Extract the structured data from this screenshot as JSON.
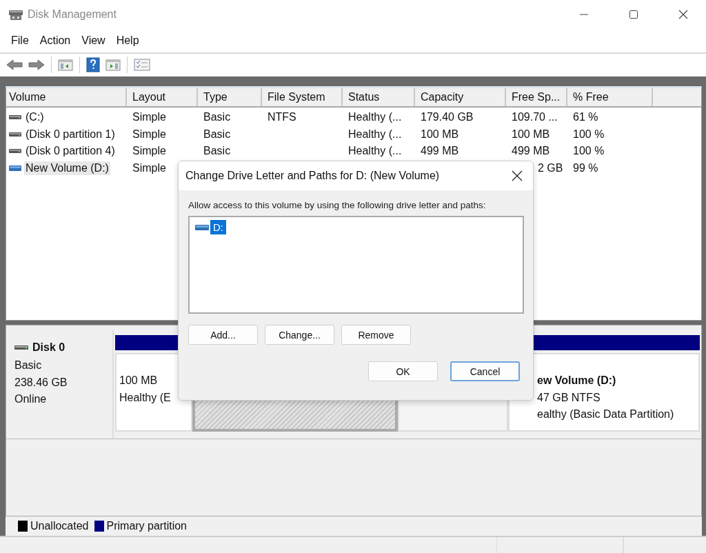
{
  "window": {
    "title": "Disk Management"
  },
  "menu": [
    "File",
    "Action",
    "View",
    "Help"
  ],
  "volume_list": {
    "columns": [
      "Volume",
      "Layout",
      "Type",
      "File System",
      "Status",
      "Capacity",
      "Free Sp...",
      "% Free"
    ],
    "rows": [
      {
        "kind": "system",
        "selected": false,
        "cells": [
          {
            "text": "(C:)"
          },
          {
            "text": "Simple"
          },
          {
            "text": "Basic"
          },
          {
            "text": "NTFS"
          },
          {
            "text": "Healthy (..."
          },
          {
            "text": "179.40 GB"
          },
          {
            "text": "109.70 ..."
          },
          {
            "text": "61 %"
          }
        ]
      },
      {
        "kind": "system",
        "selected": false,
        "cells": [
          {
            "text": "(Disk 0 partition 1)"
          },
          {
            "text": "Simple"
          },
          {
            "text": "Basic"
          },
          null,
          {
            "text": "Healthy (..."
          },
          {
            "text": "100 MB"
          },
          {
            "text": "100 MB"
          },
          {
            "text": "100 %"
          }
        ]
      },
      {
        "kind": "system",
        "selected": false,
        "cells": [
          {
            "text": "(Disk 0 partition 4)"
          },
          {
            "text": "Simple"
          },
          {
            "text": "Basic"
          },
          null,
          {
            "text": "Healthy (..."
          },
          {
            "text": "499 MB"
          },
          {
            "text": "499 MB"
          },
          {
            "text": "100 %"
          }
        ]
      },
      {
        "kind": "data",
        "selected": true,
        "cells": [
          {
            "text": "New Volume (D:)"
          },
          {
            "text": "Simple"
          },
          null,
          null,
          null,
          null,
          {
            "text": "2 GB",
            "partly_hidden": true
          },
          {
            "text": "99 %"
          }
        ]
      }
    ]
  },
  "disk": {
    "name": "Disk 0",
    "type": "Basic",
    "size": "238.46 GB",
    "state": "Online",
    "partitions": [
      {
        "selected": false,
        "lines": [
          "100 MB",
          "Healthy (E"
        ]
      },
      {
        "selected": true
      },
      {
        "selected": false
      },
      {
        "selected": false,
        "partly_hidden": true,
        "title": "ew Volume  (D:)",
        "lines": [
          "47 GB NTFS",
          "ealthy (Basic Data Partition)"
        ]
      }
    ]
  },
  "legend": [
    {
      "label": "Unallocated",
      "color": "#000000"
    },
    {
      "label": "Primary partition",
      "color": "#000080"
    }
  ],
  "dialog": {
    "title": "Change Drive Letter and Paths for D: (New Volume)",
    "prompt": "Allow access to this volume by using the following drive letter and paths:",
    "paths": [
      {
        "label": "D:",
        "selected": true
      }
    ],
    "list_buttons": [
      {
        "label": "Add...",
        "focused": false
      },
      {
        "label": "Change...",
        "focused": false
      },
      {
        "label": "Remove",
        "focused": false
      }
    ],
    "buttons": [
      {
        "label": "OK",
        "focused": false
      },
      {
        "label": "Cancel",
        "focused": true
      }
    ]
  }
}
